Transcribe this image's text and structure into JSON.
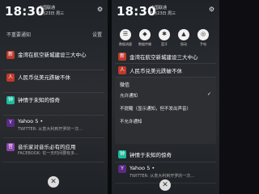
{
  "status": {
    "time": "18:30",
    "carrier_line1": "中国联通",
    "carrier_line2": "5月23日 周三",
    "right_icons": "⚙"
  },
  "left_panel": {
    "section_title": "不重要通知",
    "section_action": "设置",
    "notifications": [
      {
        "icon": "新",
        "icon_color": "#c0392b",
        "title": "金湾在航空新城建设三大中心",
        "body": "",
        "time": ""
      },
      {
        "icon": "人",
        "icon_color": "#c0392b",
        "title": "人民币兑美元跌破不休",
        "body": "",
        "time": ""
      },
      {
        "icon": "钟",
        "icon_color": "#1abc9c",
        "title": "钟情于未知的惊奇",
        "body": "",
        "time": ""
      },
      {
        "icon": "Y",
        "icon_color": "#5b2a86",
        "title": "Yahoo 5 •",
        "body": "TWITTER: 从意大利到开罗的一次...",
        "time": ""
      },
      {
        "icon": "音",
        "icon_color": "#8e44ad",
        "title": "音乐家对音乐必有的应用",
        "body": "FACEBOOK: 花一天时间要有多...",
        "time": ""
      }
    ],
    "clear": "✕"
  },
  "right_panel": {
    "quick_settings": [
      {
        "glyph": "☰",
        "label": "数据流量"
      },
      {
        "glyph": "◆",
        "label": "数据传输"
      },
      {
        "glyph": "✱",
        "label": "蓝牙"
      },
      {
        "glyph": "▲",
        "label": "振动"
      },
      {
        "glyph": "◎",
        "label": "手电"
      }
    ],
    "notifications": [
      {
        "icon": "新",
        "icon_color": "#c0392b",
        "title": "金湾在航空新城建设三大中心",
        "body": "",
        "time": ""
      },
      {
        "icon": "人",
        "icon_color": "#c0392b",
        "title": "人民币兑美元跌破不休",
        "body": "",
        "time": ""
      }
    ],
    "menu": {
      "app_name": "微信",
      "items": [
        "允许通知",
        "不提醒（显示通知，但不发出声音）",
        "不允许通知"
      ]
    },
    "after_menu": [
      {
        "icon": "钟",
        "icon_color": "#1abc9c",
        "title": "钟情于未知的惊奇",
        "body": "",
        "time": ""
      },
      {
        "icon": "Y",
        "icon_color": "#5b2a86",
        "title": "Yahoo 5 •",
        "body": "TWITTER: 从意大利到开罗的一次...",
        "time": ""
      }
    ],
    "clear": "✕"
  }
}
